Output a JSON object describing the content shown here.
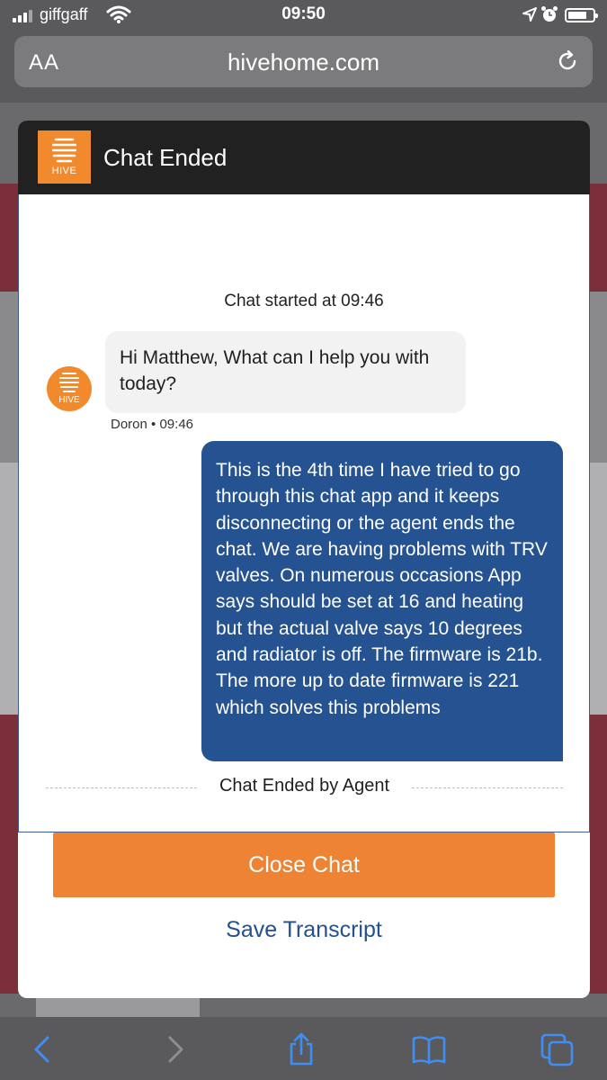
{
  "status_bar": {
    "carrier": "giffgaff",
    "time": "09:50"
  },
  "browser": {
    "aa_label": "AA",
    "url": "hivehome.com"
  },
  "chat": {
    "logo_text": "HIVE",
    "header_title": "Chat Ended",
    "started_text": "Chat started at 09:46",
    "agent_message": "Hi Matthew, What can I help you with today?",
    "agent_name": "Doron",
    "agent_time": "09:46",
    "meta_separator": "•",
    "user_message": "This  is the 4th time I have tried to go through this chat app and it keeps disconnecting or the agent ends the chat. We are having problems with TRV valves. On numerous occasions App says should be set at 16 and heating but the actual valve says 10 degrees and radiator is off. The firmware is 21b. The more up to date firmware is 221 which solves this problems",
    "ended_text": "Chat Ended by Agent",
    "close_button": "Close Chat",
    "save_link": "Save Transcript"
  },
  "colors": {
    "brand_orange": "#f08a2d",
    "user_bubble": "#255290",
    "link_blue": "#24508d",
    "header_bg": "#212121"
  },
  "icons": [
    "signal-icon",
    "wifi-icon",
    "location-icon",
    "alarm-icon",
    "battery-icon",
    "reload-icon",
    "back-icon",
    "forward-icon",
    "share-icon",
    "bookmarks-icon",
    "tabs-icon"
  ]
}
